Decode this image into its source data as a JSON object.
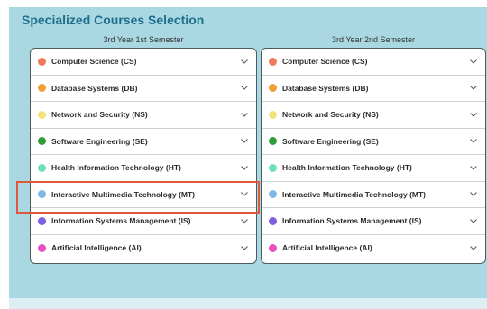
{
  "title": "Specialized Courses Selection",
  "semesters": [
    {
      "heading": "3rd Year 1st Semester",
      "courses": [
        {
          "label": "Computer Science (CS)",
          "color": "#f07a5e"
        },
        {
          "label": "Database Systems (DB)",
          "color": "#f0a035"
        },
        {
          "label": "Network and Security (NS)",
          "color": "#f2e27a"
        },
        {
          "label": "Software Engineering (SE)",
          "color": "#2f9e3a"
        },
        {
          "label": "Health Information Technology (HT)",
          "color": "#6ee0c2"
        },
        {
          "label": "Interactive Multimedia Technology (MT)",
          "color": "#7fb8e6"
        },
        {
          "label": "Information Systems Management (IS)",
          "color": "#7d5fe0"
        },
        {
          "label": "Artificial Intelligence (AI)",
          "color": "#e84fc4"
        }
      ]
    },
    {
      "heading": "3rd Year 2nd Semester",
      "courses": [
        {
          "label": "Computer Science (CS)",
          "color": "#f07a5e"
        },
        {
          "label": "Database Systems (DB)",
          "color": "#f0a035"
        },
        {
          "label": "Network and Security (NS)",
          "color": "#f2e27a"
        },
        {
          "label": "Software Engineering (SE)",
          "color": "#2f9e3a"
        },
        {
          "label": "Health Information Technology (HT)",
          "color": "#6ee0c2"
        },
        {
          "label": "Interactive Multimedia Technology (MT)",
          "color": "#7fb8e6"
        },
        {
          "label": "Information Systems Management (IS)",
          "color": "#7d5fe0"
        },
        {
          "label": "Artificial Intelligence (AI)",
          "color": "#e84fc4"
        }
      ]
    }
  ],
  "highlight_color": "#e0573a",
  "icon": "chevron-down-icon"
}
